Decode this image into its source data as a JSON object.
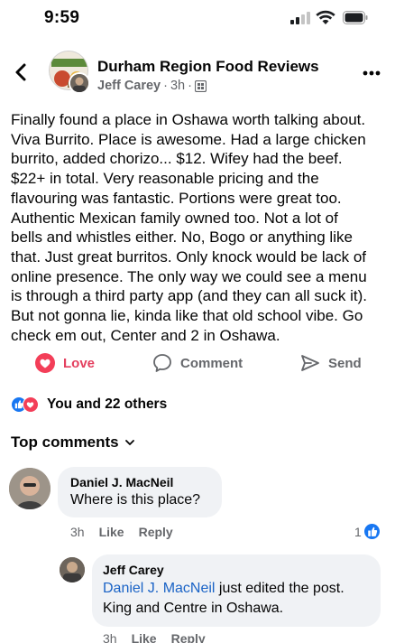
{
  "status_bar": {
    "time": "9:59"
  },
  "post": {
    "group_name": "Durham Region Food Reviews",
    "author": "Jeff Carey",
    "time_ago": "3h",
    "separator": "·",
    "body_lines": [
      "Finally found a place in Oshawa worth talking about.",
      "Viva Burrito. Place is awesome. Had a large chicken",
      "burrito, added chorizo... $12. Wifey had the beef.",
      "$22+ in total. Very reasonable pricing and the",
      "flavouring was fantastic. Portions were great too.",
      "Authentic Mexican family owned too. Not a lot of",
      "bells and whistles either. No, Bogo or anything like",
      "that. Just great burritos. Only knock would be lack of",
      "online presence. The only way we could see a menu",
      "is through a third party app (and they can all suck it).",
      "But not gonna lie, kinda like that old school vibe.  Go",
      "check em out, Center and 2 in Oshawa."
    ]
  },
  "actions": {
    "love": "Love",
    "comment": "Comment",
    "send": "Send"
  },
  "reactions": {
    "summary": "You and 22 others"
  },
  "comments_header": {
    "label": "Top comments"
  },
  "comments": [
    {
      "author": "Daniel J. MacNeil",
      "text": "Where is this place?",
      "time_ago": "3h",
      "like_label": "Like",
      "reply_label": "Reply",
      "like_count": "1"
    },
    {
      "author": "Jeff Carey",
      "mention": "Daniel J. MacNeil",
      "text_after_mention": " just edited the post.",
      "text_line2": "King and Centre in Oshawa.",
      "time_ago": "3h",
      "like_label": "Like",
      "reply_label": "Reply"
    }
  ],
  "colors": {
    "love_red": "#e4405f",
    "facebook_blue": "#1877f2",
    "mention_blue": "#1a63c6",
    "secondary_text": "#65676b",
    "bubble_bg": "#f0f2f5"
  }
}
